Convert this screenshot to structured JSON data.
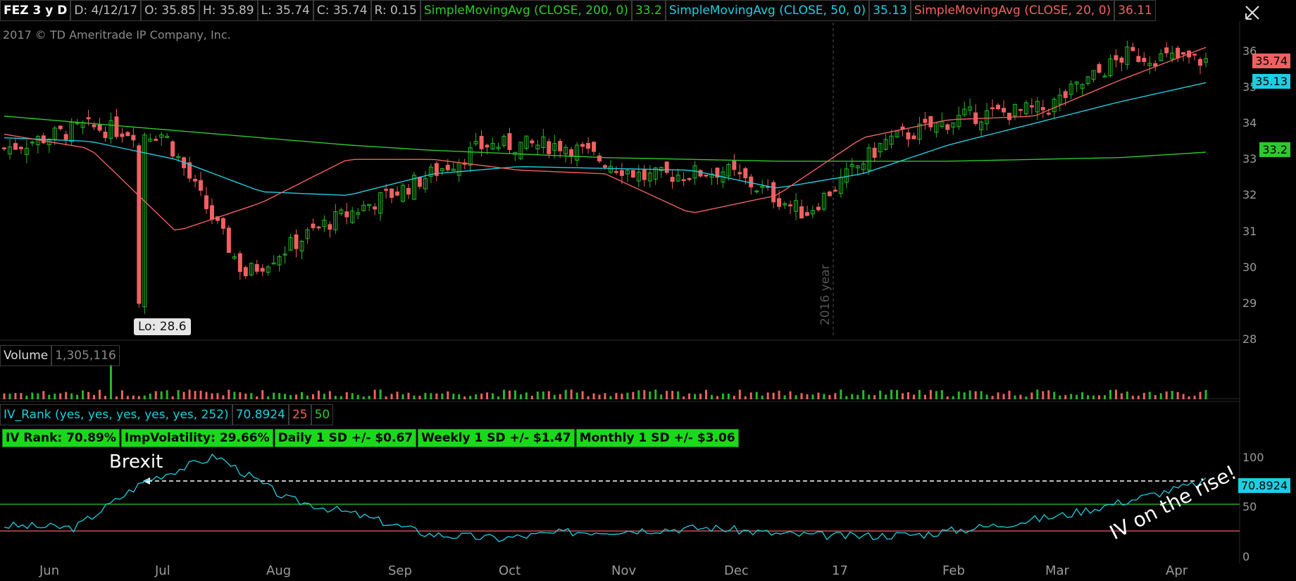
{
  "header": {
    "symbol": "FEZ 3 y D",
    "date": "D: 4/12/17",
    "open": "O: 35.85",
    "high": "H: 35.89",
    "low": "L: 35.74",
    "close": "C: 35.74",
    "range": "R: 0.15",
    "sma200_label": "SimpleMovingAvg (CLOSE, 200, 0)",
    "sma200_value": "33.2",
    "sma50_label": "SimpleMovingAvg (CLOSE, 50, 0)",
    "sma50_value": "35.13",
    "sma20_label": "SimpleMovingAvg (CLOSE, 20, 0)",
    "sma20_value": "36.11",
    "close_icon": "close-icon"
  },
  "price_pane": {
    "copyright": "2017 © TD Ameritrade IP Company, Inc.",
    "low_label": "Lo: 28.6",
    "year_marker": "2016 year",
    "y_ticks": [
      "36",
      "35",
      "34",
      "33",
      "32",
      "31",
      "30",
      "29",
      "28"
    ],
    "price_tags": {
      "last": "35.74",
      "sma50": "35.13",
      "sma200": "33.2"
    }
  },
  "volume_pane": {
    "label": "Volume",
    "value": "1,305,116"
  },
  "iv_pane": {
    "label": "IV_Rank (yes, yes, yes, yes, yes, 252)",
    "value": "70.8924",
    "low_line": "25",
    "high_line": "50",
    "stats": [
      "IV Rank: 70.89%",
      "ImpVolatility: 29.66%",
      "Daily 1 SD +/- $0.67",
      "Weekly 1 SD +/- $1.47",
      "Monthly 1 SD +/- $3.06"
    ],
    "y_ticks": [
      "100",
      "50",
      "0"
    ],
    "tag": "70.8924",
    "annotation_brexit": "Brexit",
    "annotation_rise": "IV on the rise!"
  },
  "x_axis": {
    "labels": [
      "Jun",
      "Jul",
      "Aug",
      "Sep",
      "Oct",
      "Nov",
      "Dec",
      "17",
      "Feb",
      "Mar",
      "Apr"
    ]
  },
  "colors": {
    "up": "#27b827",
    "down": "#f06060",
    "sma200": "#2ec82e",
    "sma50": "#1ccfe0",
    "sma20": "#f06060",
    "iv": "#1ccfe0"
  },
  "chart_data": {
    "type": "line",
    "symbol": "FEZ",
    "ylim": [
      28,
      36.8
    ],
    "series": [
      {
        "name": "SimpleMovingAvg (CLOSE, 200, 0)",
        "values": [
          34.2,
          34.0,
          33.8,
          33.6,
          33.4,
          33.25,
          33.15,
          33.05,
          33.0,
          32.95,
          32.95,
          32.95,
          33.0,
          33.05,
          33.2
        ]
      },
      {
        "name": "SimpleMovingAvg (CLOSE, 50, 0)",
        "values": [
          33.6,
          33.5,
          33.0,
          32.1,
          32.0,
          32.6,
          32.8,
          32.75,
          32.7,
          32.2,
          32.6,
          33.4,
          34.0,
          34.6,
          35.13
        ]
      },
      {
        "name": "SimpleMovingAvg (CLOSE, 20, 0)",
        "values": [
          33.7,
          33.3,
          31.0,
          31.8,
          33.0,
          33.0,
          32.7,
          32.6,
          31.5,
          32.0,
          33.6,
          34.1,
          34.2,
          35.2,
          36.11
        ]
      }
    ],
    "close": [
      33.3,
      33.9,
      33.7,
      29.8,
      31.2,
      32.2,
      33.4,
      33.4,
      32.5,
      32.7,
      31.5,
      33.5,
      34.2,
      34.4,
      35.9,
      35.74
    ],
    "low": 28.6,
    "iv_rank": [
      30,
      28,
      72,
      95,
      55,
      40,
      22,
      18,
      24,
      26,
      28,
      22,
      20,
      22,
      30,
      40,
      55,
      70.89
    ]
  }
}
